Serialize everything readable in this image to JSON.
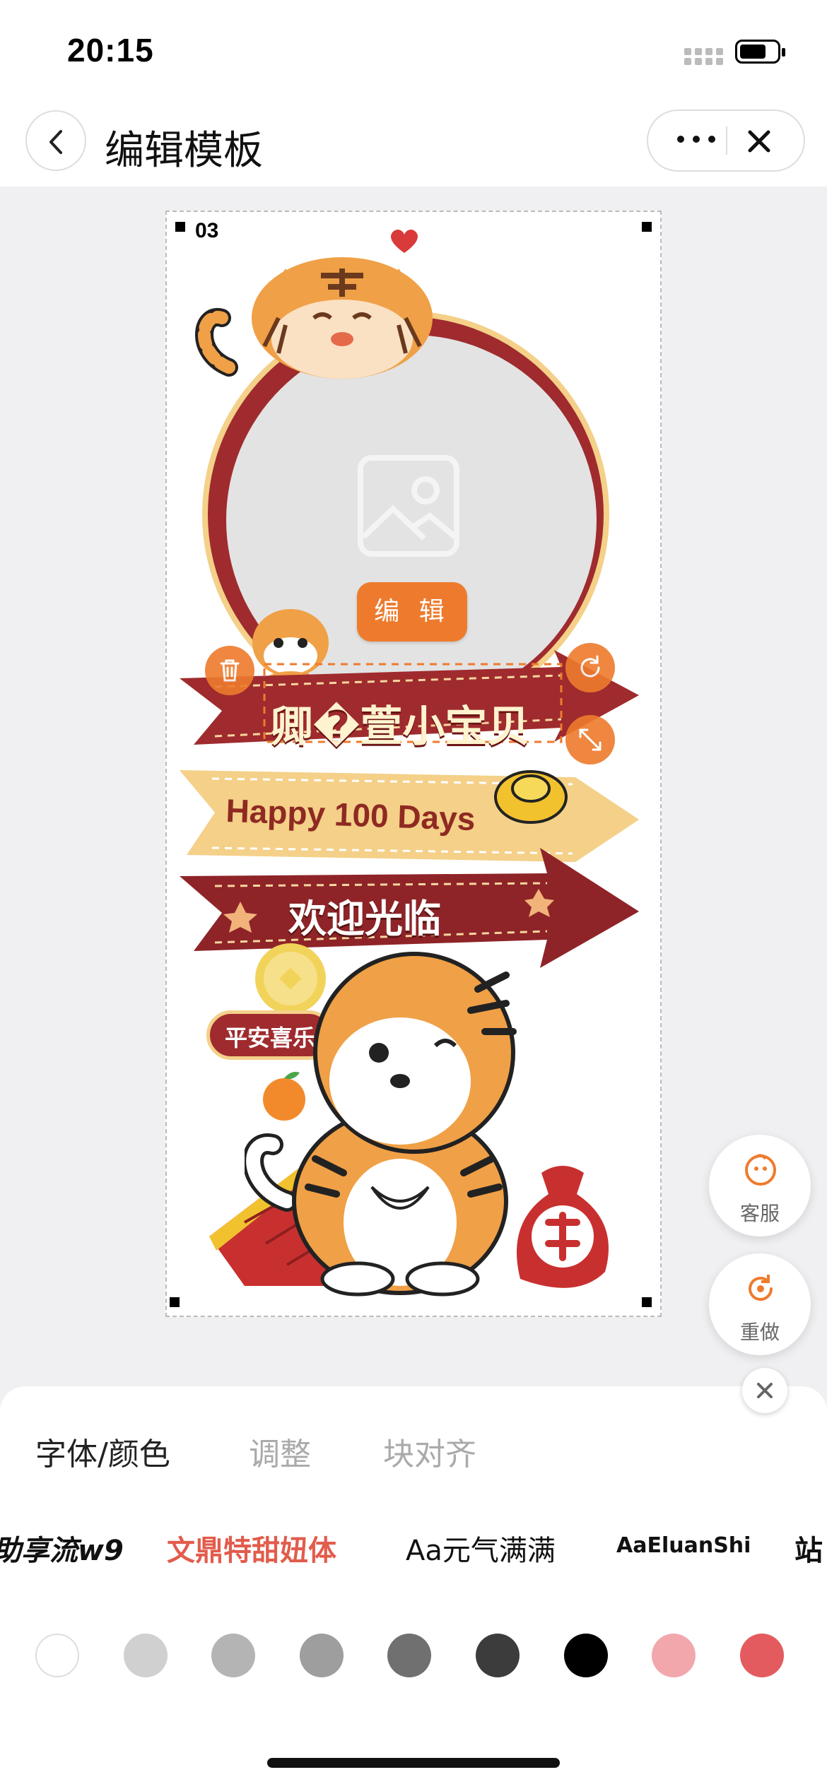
{
  "status": {
    "time": "20:15"
  },
  "nav": {
    "title": "编辑模板"
  },
  "template": {
    "page_number": "03",
    "edit_label": "编 辑",
    "name_text": "卿�萱小宝贝",
    "happy_text": "Happy 100 Days",
    "welcome_text": "欢迎光临",
    "badge_text": "平安喜乐"
  },
  "float": {
    "service_label": "客服",
    "redo_label": "重做"
  },
  "panel": {
    "tabs": [
      "字体/颜色",
      "调整",
      "块对齐"
    ],
    "fonts": [
      "助享流w9",
      "文鼎特甜妞体",
      "Aa元气满满",
      "AaEluanShi",
      "站"
    ],
    "colors": [
      "#ffffff",
      "#d0d0d0",
      "#b4b4b4",
      "#9e9e9e",
      "#707070",
      "#3c3c3c",
      "#000000",
      "#f2a7ad",
      "#e35b5f"
    ]
  },
  "theme": {
    "accent": "#ee7b2d",
    "banner_red": "#9f2b2e",
    "banner_yellow": "#f4d089"
  }
}
